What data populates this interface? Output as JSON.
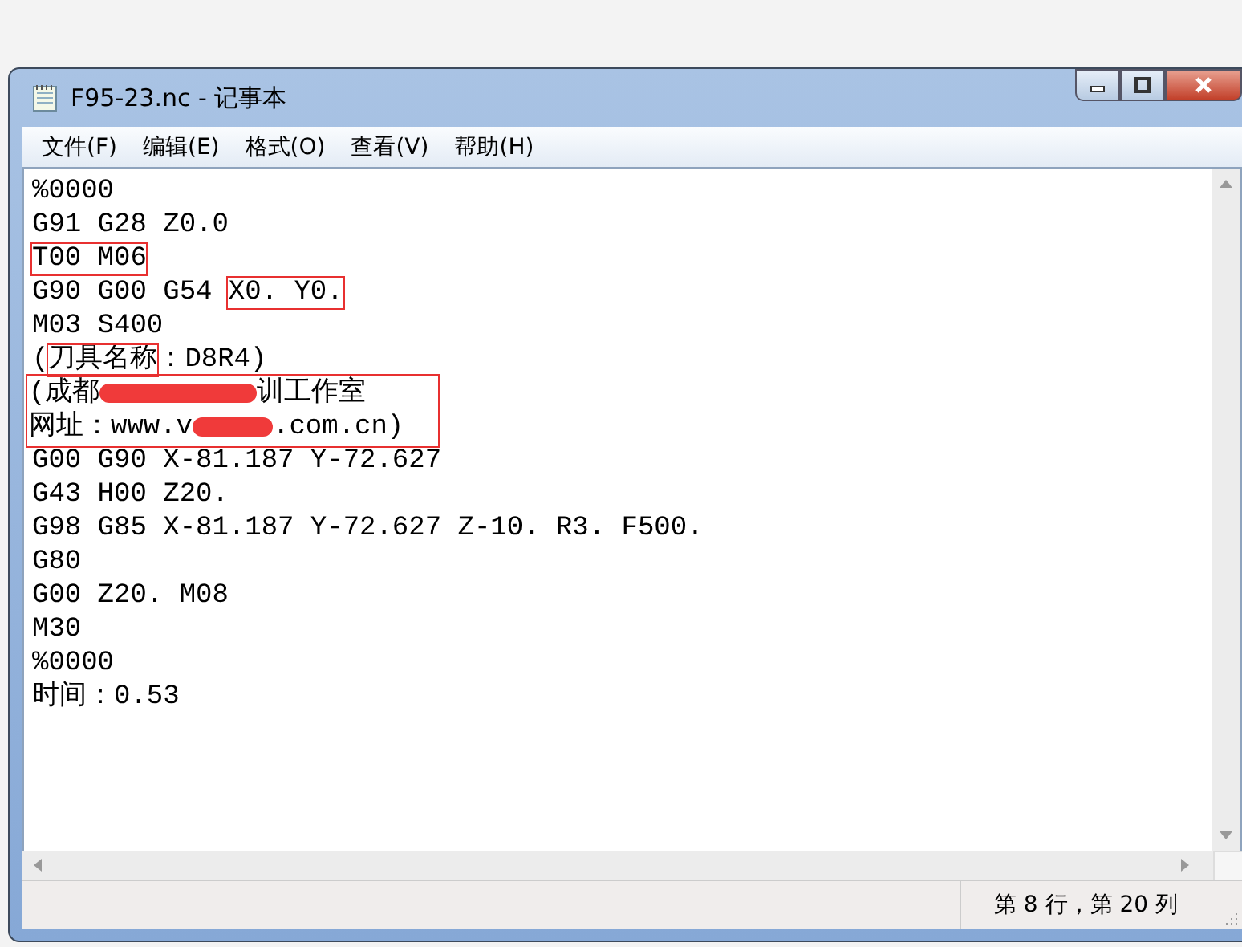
{
  "window": {
    "title": "F95-23.nc - 记事本"
  },
  "menu": [
    "文件(F)",
    "编辑(E)",
    "格式(O)",
    "查看(V)",
    "帮助(H)"
  ],
  "blocks": [
    {
      "boxed": false,
      "lines": [
        [
          {
            "kind": "text",
            "text": "%0000"
          }
        ],
        [
          {
            "kind": "text",
            "text": "G91 G28 Z0.0"
          }
        ]
      ]
    },
    {
      "boxed": false,
      "lines": [
        [
          {
            "kind": "boxed",
            "text": "T00 M06"
          }
        ],
        [
          {
            "kind": "text",
            "text": "G90 G00 G54 "
          },
          {
            "kind": "boxed",
            "text": "X0. Y0."
          }
        ],
        [
          {
            "kind": "text",
            "text": "M03 S400"
          }
        ],
        [
          {
            "kind": "text",
            "text": "("
          },
          {
            "kind": "boxed",
            "text": "刀具名称"
          },
          {
            "kind": "text",
            "text": "：D8R4)"
          }
        ]
      ]
    },
    {
      "boxed": true,
      "lines": [
        [
          {
            "kind": "text",
            "text": "(成都"
          },
          {
            "kind": "redaction"
          },
          {
            "kind": "text",
            "text": "训工作室"
          }
        ],
        [
          {
            "kind": "text",
            "text": "网址：www.v"
          },
          {
            "kind": "redaction"
          },
          {
            "kind": "text",
            "text": ".com.cn)"
          }
        ]
      ]
    },
    {
      "boxed": false,
      "lines": [
        [
          {
            "kind": "text",
            "text": "G00 G90 X-81.187 Y-72.627"
          }
        ],
        [
          {
            "kind": "text",
            "text": "G43 H00 Z20."
          }
        ],
        [
          {
            "kind": "text",
            "text": "G98 G85 X-81.187 Y-72.627 Z-10. R3. F500."
          }
        ],
        [
          {
            "kind": "text",
            "text": "G80"
          }
        ],
        [
          {
            "kind": "text",
            "text": "G00 Z20. M08"
          }
        ],
        [
          {
            "kind": "text",
            "text": "M30"
          }
        ],
        [
          {
            "kind": "text",
            "text": "%0000"
          }
        ],
        [
          {
            "kind": "text",
            "text": "时间：0.53"
          }
        ]
      ]
    }
  ],
  "status_bar": {
    "position": "第 8 行，第 20 列"
  }
}
